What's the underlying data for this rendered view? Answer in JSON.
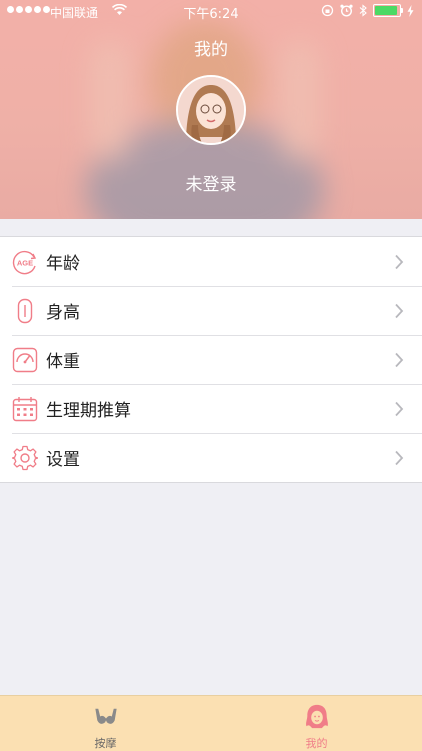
{
  "status_bar": {
    "carrier": "中国联通",
    "time": "下午6:24",
    "battery_level": 0.9
  },
  "header": {
    "title": "我的",
    "login_status": "未登录",
    "avatar_icon": "user-avatar"
  },
  "menu": {
    "items": [
      {
        "label": "年龄",
        "icon": "age-icon"
      },
      {
        "label": "身高",
        "icon": "height-icon"
      },
      {
        "label": "体重",
        "icon": "scale-icon"
      },
      {
        "label": "生理期推算",
        "icon": "calendar-icon"
      },
      {
        "label": "设置",
        "icon": "gear-icon"
      }
    ],
    "icon_age_text": "AGE"
  },
  "tabbar": {
    "tabs": [
      {
        "label": "按摩",
        "icon": "bra-icon",
        "active": false
      },
      {
        "label": "我的",
        "icon": "girl-icon",
        "active": true
      }
    ]
  },
  "colors": {
    "accent": "#f07d88",
    "header_bg": "#f3b0a8",
    "tabbar_bg": "#fbe0b2"
  }
}
